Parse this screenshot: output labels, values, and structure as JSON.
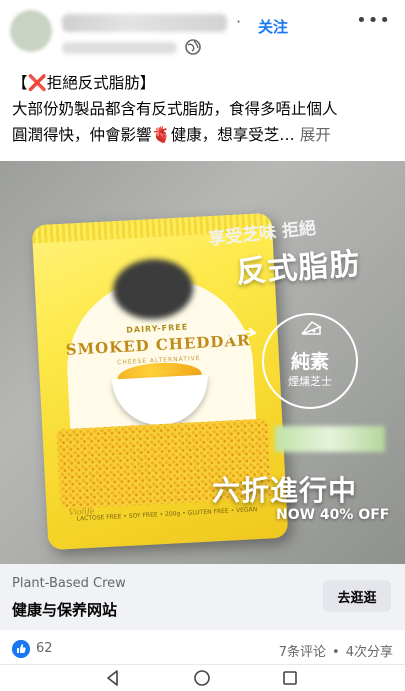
{
  "post": {
    "follow_label": "关注",
    "more_icon": "more-horizontal-icon",
    "audience_icon": "globe-icon",
    "text_line1": "【❌拒絕反式脂肪】",
    "text_line2": "大部份奶製品都含有反式脂肪，食得多唔止個人",
    "text_line3": "圓潤得快，仲會影響🫀健康，想享受芝…",
    "see_more": "展开"
  },
  "image": {
    "bag_subtitle": "DAIRY-FREE",
    "bag_title": "SMOKED CHEDDAR",
    "bag_alt": "CHEESE ALTERNATIVE",
    "bag_brand": "Violife",
    "bag_bottom": "LACTOSE FREE • SOY FREE • 200g • GLUTEN FREE • VEGAN",
    "overlay_top": "享受芝味 拒絕",
    "overlay_main": "反式脂肪",
    "circle_line1": "純素",
    "circle_line2": "煙燻芝士",
    "sale_main": "六折進行中",
    "sale_sub": "NOW 40% OFF"
  },
  "link": {
    "domain": "Plant-Based Crew",
    "title": "健康与保养网站",
    "cta_label": "去逛逛"
  },
  "reactions": {
    "like_count": "62",
    "comments": "7条评论",
    "shares": "4次分享",
    "separator": "•"
  },
  "nav": {
    "back_icon": "back-triangle-icon",
    "home_icon": "home-circle-icon",
    "recents_icon": "recents-square-icon"
  },
  "colors": {
    "accent": "#1877f2",
    "muted_text": "#65676b",
    "link_bar_bg": "#f0f2f5",
    "bag_yellow": "#fde94a"
  }
}
